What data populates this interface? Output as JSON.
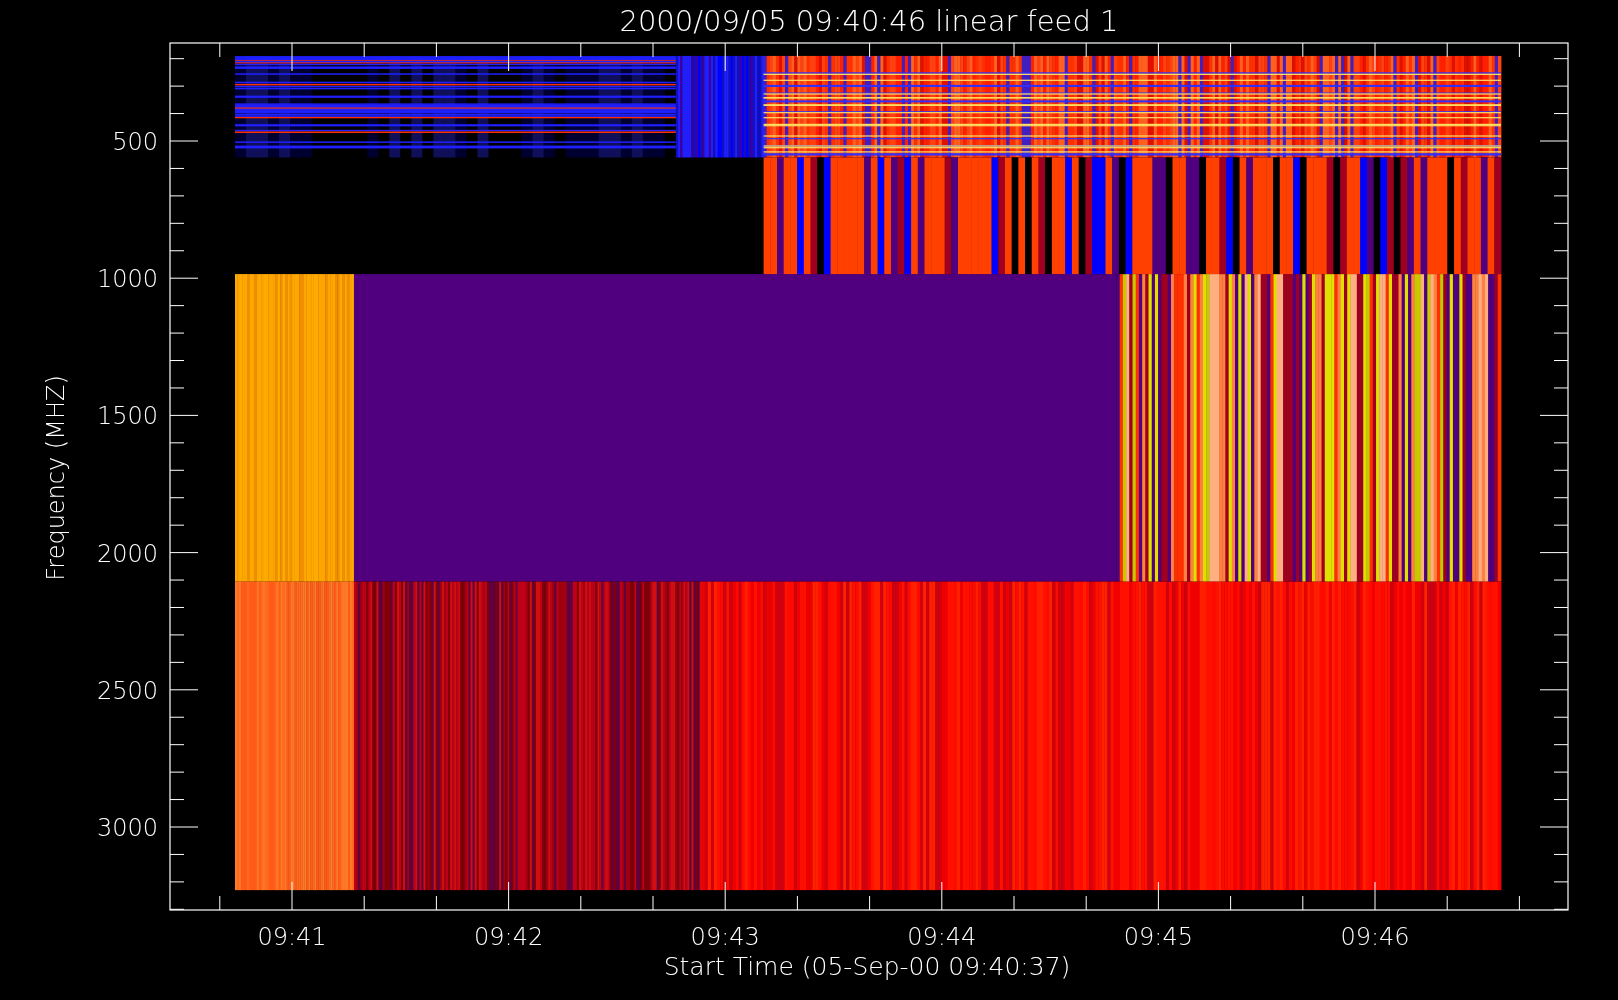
{
  "title": "2000/09/05 09:40:46 linear feed 1",
  "y_axis": {
    "label": "Frequency (MHZ)",
    "ticks": [
      "500",
      "1000",
      "1500",
      "2000",
      "2500",
      "3000"
    ]
  },
  "x_axis": {
    "label": "Start Time (05-Sep-00 09:40:37)",
    "ticks": [
      "09:41",
      "09:42",
      "09:43",
      "09:44",
      "09:45",
      "09:46"
    ]
  }
}
